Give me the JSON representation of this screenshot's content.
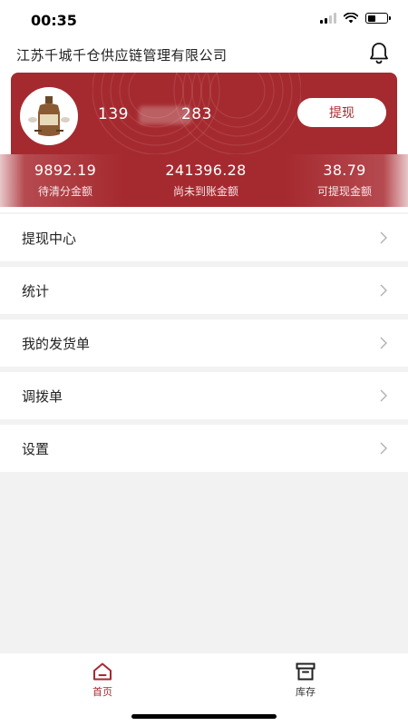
{
  "status_bar": {
    "time": "00:35"
  },
  "header": {
    "company_name": "江苏千城千仓供应链管理有限公司"
  },
  "profile": {
    "phone_prefix": "139",
    "phone_suffix": "283",
    "withdraw_label": "提现"
  },
  "stats": [
    {
      "value": "9892.19",
      "label": "待清分金额"
    },
    {
      "value": "241396.28",
      "label": "尚未到账金额"
    },
    {
      "value": "38.79",
      "label": "可提现金额"
    }
  ],
  "menu": [
    {
      "label": "提现中心"
    },
    {
      "label": "统计"
    },
    {
      "label": "我的发货单"
    },
    {
      "label": "调拨单"
    },
    {
      "label": "设置"
    }
  ],
  "tabbar": [
    {
      "label": "首页",
      "icon": "home-icon",
      "active": true
    },
    {
      "label": "库存",
      "icon": "archive-icon",
      "active": false
    }
  ],
  "colors": {
    "brand": "#a52a2f",
    "background": "#f2f2f2"
  }
}
